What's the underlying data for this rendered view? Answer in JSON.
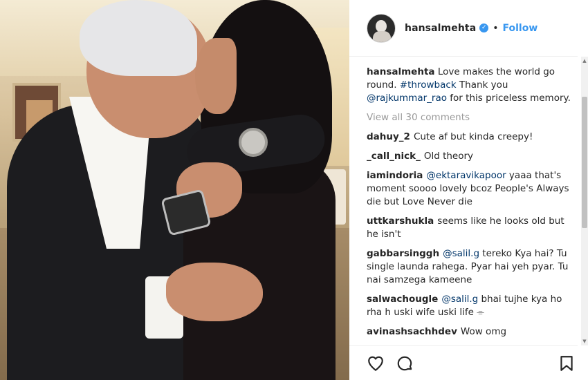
{
  "post": {
    "username": "hansalmehta",
    "verified_icon": "verified-badge-icon",
    "separator": "•",
    "follow_label": "Follow",
    "accent_color": "#3897f0"
  },
  "caption": {
    "username": "hansalmehta",
    "text_1": "Love makes the world go round. ",
    "hashtag": "#throwback",
    "text_2": " Thank you ",
    "mention": "@rajkummar_rao",
    "text_3": " for this priceless memory."
  },
  "view_all_label": "View all 30 comments",
  "comments": [
    {
      "user": "dahuy_2",
      "text": "Cute af but kinda creepy!"
    },
    {
      "user": "_call_nick_",
      "text": "Old theory"
    },
    {
      "user": "iamindoria",
      "mention": "@ektaravikapoor",
      "text": " yaaa that's moment soooo lovely bcoz People's Always die but Love Never die"
    },
    {
      "user": "uttkarshukla",
      "text": "seems like he looks old but he isn't"
    },
    {
      "user": "gabbarsinggh",
      "mention": "@salil.g",
      "text": " tereko Kya hai? Tu single launda rahega. Pyar hai yeh pyar. Tu nai samzega kameene"
    },
    {
      "user": "salwachougle",
      "mention": "@salil.g",
      "text": " bhai tujhe kya ho rha h uski wife uski life ⌯"
    },
    {
      "user": "avinashsachhdev",
      "text": "Wow omg"
    }
  ],
  "actions": {
    "like_icon": "heart-icon",
    "comment_icon": "comment-icon",
    "save_icon": "bookmark-icon"
  }
}
